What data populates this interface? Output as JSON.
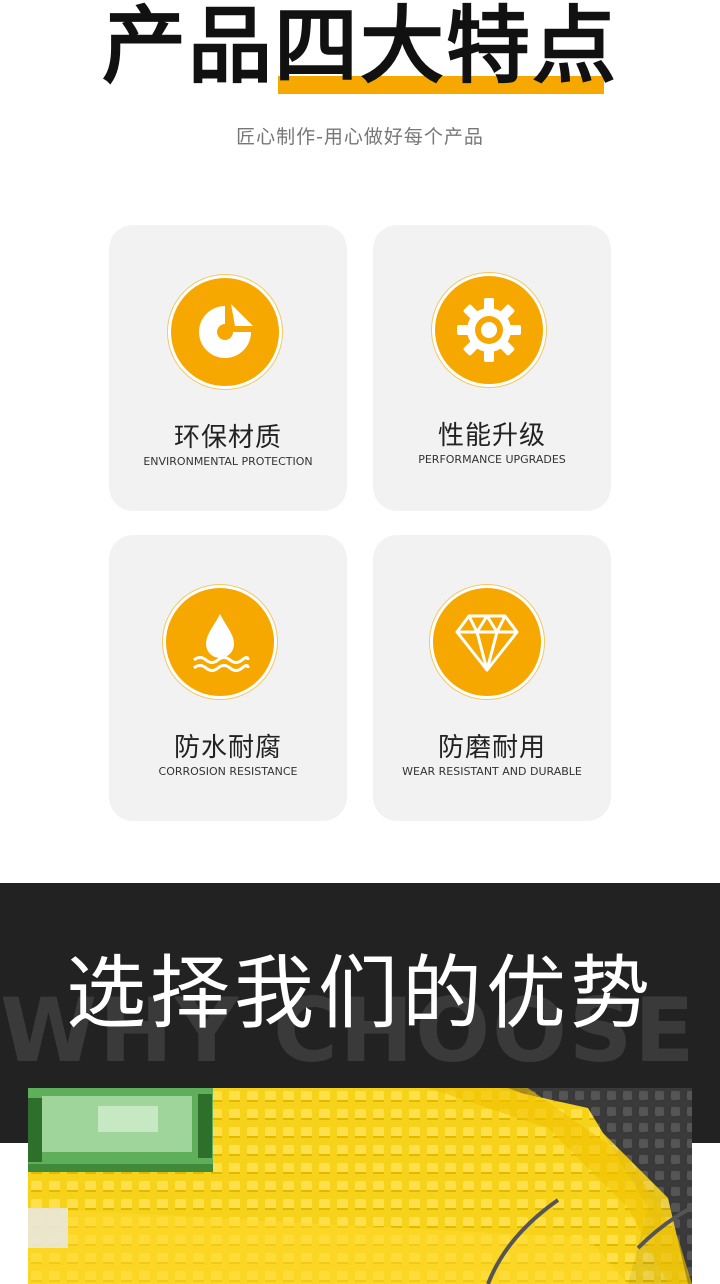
{
  "header": {
    "title_part1": "产品",
    "title_part2": "四大特点",
    "subtitle": "匠心制作-用心做好每个产品"
  },
  "features": [
    {
      "cn": "环保材质",
      "en": "ENVIRONMENTAL PROTECTION",
      "icon": "eco-chart-icon"
    },
    {
      "cn": "性能升级",
      "en": "PERFORMANCE UPGRADES",
      "icon": "gear-icon"
    },
    {
      "cn": "防水耐腐",
      "en": "CORROSION RESISTANCE",
      "icon": "water-drop-icon"
    },
    {
      "cn": "防磨耐用",
      "en": "WEAR RESISTANT AND DURABLE",
      "icon": "diamond-icon"
    }
  ],
  "advantages": {
    "title": "选择我们的优势",
    "background_text": "WHY CHOOSE US"
  },
  "colors": {
    "accent": "#f6a800",
    "card_bg": "#f2f2f2",
    "dark_band": "#222222"
  }
}
